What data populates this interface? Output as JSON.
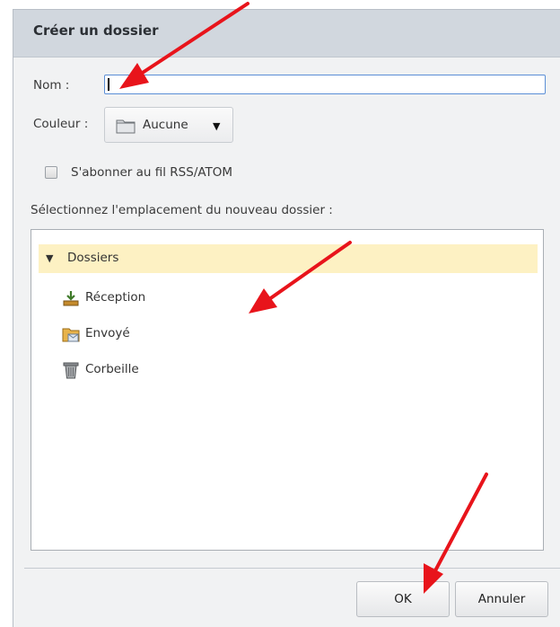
{
  "dialog": {
    "title": "Créer un dossier"
  },
  "form": {
    "name_label": "Nom :",
    "name_value": "",
    "color_label": "Couleur :",
    "color_value": "Aucune",
    "subscribe_label": "S'abonner au fil RSS/ATOM",
    "subscribe_checked": false,
    "location_label": "Sélectionnez l'emplacement du nouveau dossier :"
  },
  "tree": {
    "root": "Dossiers",
    "items": [
      {
        "label": "Réception",
        "icon": "inbox-download-icon"
      },
      {
        "label": "Envoyé",
        "icon": "sent-folder-icon"
      },
      {
        "label": "Corbeille",
        "icon": "trash-icon"
      }
    ]
  },
  "buttons": {
    "ok": "OK",
    "cancel": "Annuler"
  },
  "colors": {
    "titlebar": "#d1d7de",
    "selected_row": "#fdf1c3",
    "input_focus": "#5b8fd6",
    "annotation_arrow": "#e8141b"
  }
}
